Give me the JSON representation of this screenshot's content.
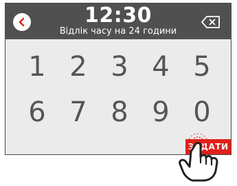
{
  "header": {
    "time": "12:30",
    "subtitle": "Відлік часу на 24 години",
    "back_icon": "chevron-left-icon",
    "delete_icon": "backspace-icon"
  },
  "keypad": {
    "keys": [
      "1",
      "2",
      "3",
      "4",
      "5",
      "6",
      "7",
      "8",
      "9",
      "0"
    ]
  },
  "actions": {
    "set_label": "ЗАДАТИ"
  },
  "colors": {
    "header_bg": "#505050",
    "screen_bg": "#ebebeb",
    "accent_red": "#e0201b",
    "digit_gray": "#555555"
  }
}
